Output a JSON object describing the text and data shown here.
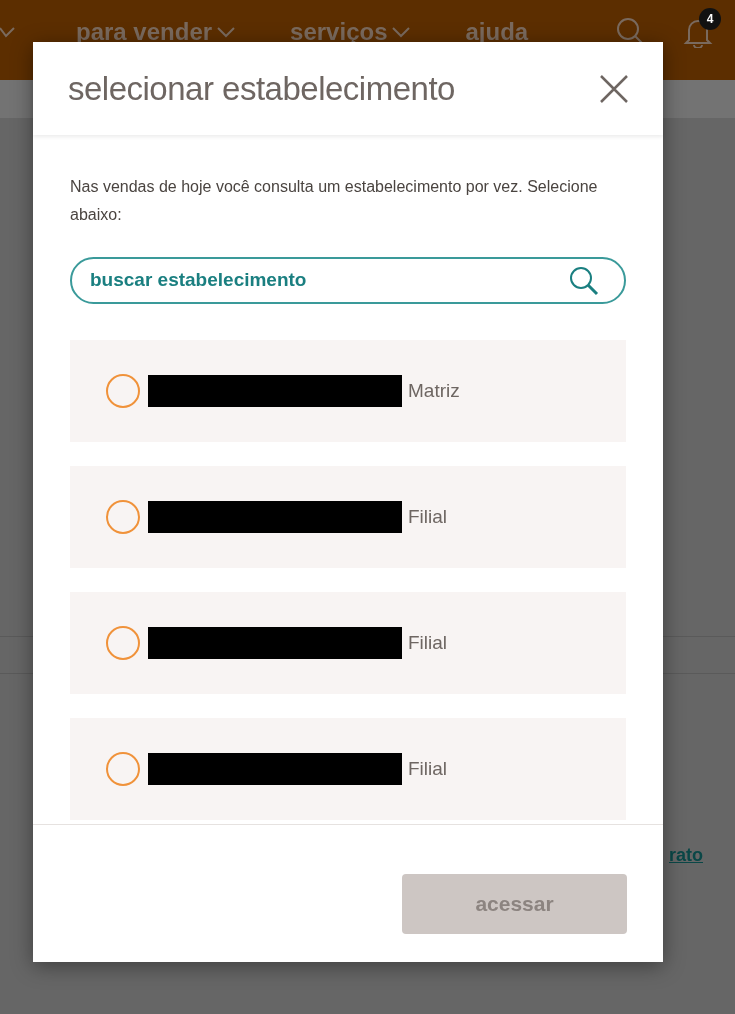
{
  "nav": {
    "items": [
      {
        "label": "para vender",
        "has_menu": true
      },
      {
        "label": "serviços",
        "has_menu": true
      },
      {
        "label": "ajuda",
        "has_menu": false
      }
    ],
    "notification_count": "4"
  },
  "background_link": "rato",
  "dialog": {
    "title": "selecionar estabelecimento",
    "description": "Nas vendas de hoje você consulta um estabelecimento por vez. Selecione abaixo:",
    "search": {
      "placeholder": "buscar estabelecimento"
    },
    "options": [
      {
        "label": "Matriz",
        "selected": false
      },
      {
        "label": "Filial",
        "selected": false
      },
      {
        "label": "Filial",
        "selected": false
      },
      {
        "label": "Filial",
        "selected": false
      }
    ],
    "submit": {
      "label": "acessar",
      "disabled": true
    }
  }
}
